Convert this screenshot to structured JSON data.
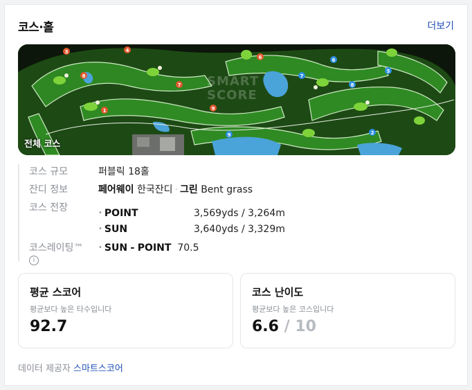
{
  "header": {
    "title": "코스·홀",
    "more_label": "더보기"
  },
  "map": {
    "label": "전체 코스",
    "watermark_line1": "SMART",
    "watermark_line2": "SCORE",
    "holes": [
      "1",
      "2",
      "3",
      "4",
      "5",
      "6",
      "7",
      "8",
      "9"
    ]
  },
  "info": {
    "size_label": "코스 규모",
    "size_value": "퍼블릭 18홀",
    "grass_label": "잔디 정보",
    "grass_fairway": "페어웨이",
    "grass_fairway_type": "한국잔디",
    "grass_green": "그린",
    "grass_green_type": "Bent grass",
    "length_label": "코스 전장",
    "lengths": [
      {
        "name": "POINT",
        "value": "3,569yds / 3,264m"
      },
      {
        "name": "SUN",
        "value": "3,640yds / 3,329m"
      }
    ],
    "rating_label": "코스레이팅™",
    "rating_course_a": "SUN",
    "rating_dash": "-",
    "rating_course_b": "POINT",
    "rating_value": "70.5"
  },
  "score_box": {
    "title": "평균 스코어",
    "subtitle": "평균보다 높은 타수입니다",
    "value": "92.7"
  },
  "difficulty_box": {
    "title": "코스 난이도",
    "subtitle": "평균보다 높은 코스입니다",
    "value": "6.6",
    "max": "/ 10"
  },
  "footer": {
    "prefix": "데이터 제공자",
    "provider": "스마트스코어"
  },
  "colors": {
    "accent": "#1f4fb6",
    "fairway": "#2f8a23",
    "green": "#7ed33a",
    "water": "#4aa3d9"
  }
}
